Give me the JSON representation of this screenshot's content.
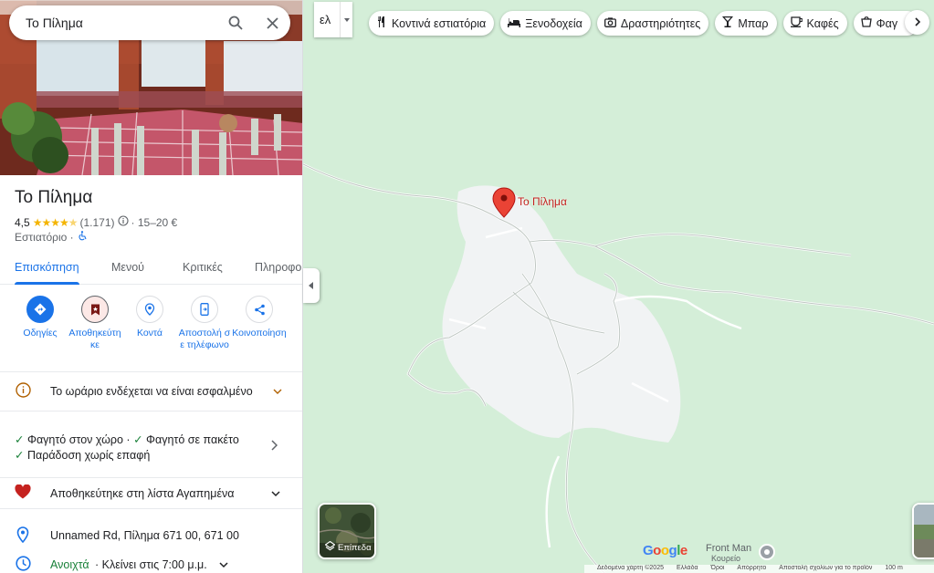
{
  "search": {
    "query": "Το Πίλημα"
  },
  "place": {
    "name": "Το Πίλημα",
    "rating": "4,5",
    "reviews_count": "(1.171)",
    "price": "· 15–20 €",
    "category": "Εστιατόριο ·"
  },
  "tabs": [
    "Επισκόπηση",
    "Μενού",
    "Κριτικές",
    "Πληροφο"
  ],
  "actions": {
    "directions": "Οδηγίες",
    "saved": "Αποθηκεύτηκε",
    "nearby": "Κοντά",
    "send_to_phone": "Αποστολή σε τηλέφωνο",
    "share": "Κοινοποίηση"
  },
  "notices": {
    "hours_warning": "Το ωράριο ενδέχεται να είναι εσφαλμένο",
    "service_dine_in": "Φαγητό στον χώρο ·",
    "service_takeout": "Φαγητό σε πακέτο",
    "service_delivery": "Παράδοση χωρίς επαφή",
    "saved_list": "Αποθηκεύτηκε στη λίστα Αγαπημένα",
    "address": "Unnamed Rd, Πίλημα 671 00, 671 00",
    "open_status": "Ανοιχτά",
    "closes": "· Κλείνει στις 7:00 μ.μ."
  },
  "map": {
    "language_toggle": "ελ",
    "chips": [
      "Κοντινά εστιατόρια",
      "Ξενοδοχεία",
      "Δραστηριότητες",
      "Μπαρ",
      "Καφές",
      "Φαγ"
    ],
    "marker_label": "Το Πίλημα",
    "poi_label": "Front Man",
    "poi_sublabel": "Κουρείο",
    "layers_label": "Επίπεδα",
    "google_logo": "Google",
    "footer": [
      "Δεδομένα χάρτη ©2025",
      "Ελλάδα",
      "Όροι",
      "Απόρρητο",
      "Αποστολή σχολίων για το προϊόν",
      "100 m"
    ]
  },
  "colors": {
    "accent": "#1a73e8",
    "marker": "#ea4335",
    "star": "#f4b400",
    "open": "#188038",
    "heart": "#c5221f",
    "map_green": "#d4eed8",
    "map_area": "#f1f3f4"
  }
}
